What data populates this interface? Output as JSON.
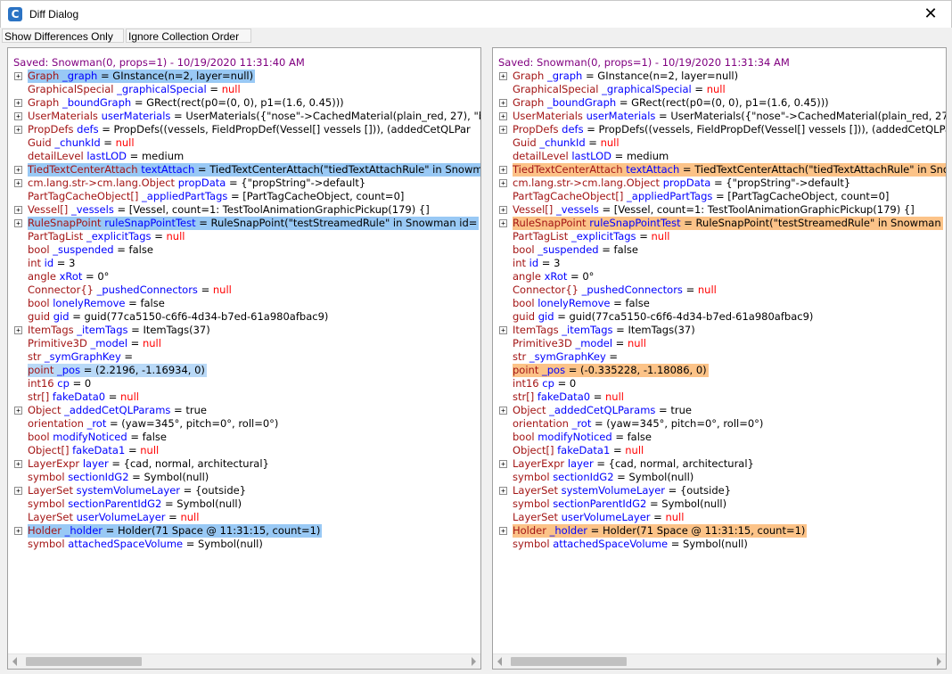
{
  "window": {
    "title": "Diff Dialog",
    "close": "✕",
    "app_icon": "C"
  },
  "toolbar": {
    "show_diffs": "Show Differences Only",
    "ignore_order": "Ignore Collection Order"
  },
  "left": {
    "header": "Saved: Snowman(0, props=1) - 10/19/2020 11:31:40 AM",
    "rows": [
      {
        "exp": true,
        "t": "Graph",
        "n": "_graph",
        "v": " = GInstance(n=2, layer=null)",
        "hl": "hl-blue",
        "nul": false
      },
      {
        "exp": false,
        "t": "GraphicalSpecial",
        "n": "_graphicalSpecial",
        "v": " = ",
        "nv": "null",
        "hl": ""
      },
      {
        "exp": true,
        "t": "Graph",
        "n": "_boundGraph",
        "v": " = GRect(rect(p0=(0, 0), p1=(1.6, 0.45)))",
        "hl": ""
      },
      {
        "exp": true,
        "t": "UserMaterials",
        "n": "userMaterials",
        "v": " = UserMaterials({\"nose\"->CachedMaterial(plain_red, 27), \"b",
        "hl": ""
      },
      {
        "exp": true,
        "t": "PropDefs",
        "n": "defs",
        "v": " = PropDefs((vessels, FieldPropDef(Vessel[] vessels [])), (addedCetQLPar",
        "hl": ""
      },
      {
        "exp": false,
        "t": "Guid",
        "n": "_chunkId",
        "v": " = ",
        "nv": "null",
        "hl": ""
      },
      {
        "exp": false,
        "t": "detailLevel",
        "n": "lastLOD",
        "v": " = medium",
        "hl": ""
      },
      {
        "exp": true,
        "t": "TiedTextCenterAttach",
        "n": "textAttach",
        "v": " = TiedTextCenterAttach(\"tiedTextAttachRule\" in Snowm",
        "hl": "hl-blue"
      },
      {
        "exp": true,
        "t": "cm.lang.str->cm.lang.Object",
        "n": "propData",
        "v": " = {\"propString\"->default}",
        "hl": ""
      },
      {
        "exp": false,
        "t": "PartTagCacheObject[]",
        "n": "_appliedPartTags",
        "v": " = [PartTagCacheObject, count=0]",
        "hl": ""
      },
      {
        "exp": true,
        "t": "Vessel[]",
        "n": "_vessels",
        "v": " = [Vessel, count=1: TestToolAnimationGraphicPickup(179) {]",
        "hl": ""
      },
      {
        "exp": true,
        "t": "RuleSnapPoint",
        "n": "ruleSnapPointTest",
        "v": " = RuleSnapPoint(\"testStreamedRule\" in Snowman id=",
        "hl": "hl-blue"
      },
      {
        "exp": false,
        "t": "PartTagList",
        "n": "_explicitTags",
        "v": " = ",
        "nv": "null",
        "hl": ""
      },
      {
        "exp": false,
        "t": "bool",
        "n": "_suspended",
        "v": " = false",
        "hl": ""
      },
      {
        "exp": false,
        "t": "int",
        "n": "id",
        "v": " = 3",
        "hl": ""
      },
      {
        "exp": false,
        "t": "angle",
        "n": "xRot",
        "v": " = 0°",
        "hl": ""
      },
      {
        "exp": false,
        "t": "Connector{}",
        "n": "_pushedConnectors",
        "v": " = ",
        "nv": "null",
        "hl": ""
      },
      {
        "exp": false,
        "t": "bool",
        "n": "lonelyRemove",
        "v": " = false",
        "hl": ""
      },
      {
        "exp": false,
        "t": "guid",
        "n": "gid",
        "v": " = guid(77ca5150-c6f6-4d34-b7ed-61a980afbac9)",
        "hl": ""
      },
      {
        "exp": true,
        "t": "ItemTags",
        "n": "_itemTags",
        "v": " = ItemTags(37)",
        "hl": ""
      },
      {
        "exp": false,
        "t": "Primitive3D",
        "n": "_model",
        "v": " = ",
        "nv": "null",
        "hl": ""
      },
      {
        "exp": false,
        "t": "str",
        "n": "_symGraphKey",
        "v": " =",
        "hl": ""
      },
      {
        "exp": false,
        "t": "point",
        "n": "_pos",
        "v": " = (2.2196, -1.16934, 0)",
        "hl": "hl-blue2"
      },
      {
        "exp": false,
        "t": "int16",
        "n": "cp",
        "v": " = 0",
        "hl": ""
      },
      {
        "exp": false,
        "t": "str[]",
        "n": "fakeData0",
        "v": " = ",
        "nv": "null",
        "hl": ""
      },
      {
        "exp": true,
        "t": "Object",
        "n": "_addedCetQLParams",
        "v": " = true",
        "hl": ""
      },
      {
        "exp": false,
        "t": "orientation",
        "n": "_rot",
        "v": " = (yaw=345°, pitch=0°, roll=0°)",
        "hl": ""
      },
      {
        "exp": false,
        "t": "bool",
        "n": "modifyNoticed",
        "v": " = false",
        "hl": ""
      },
      {
        "exp": false,
        "t": "Object[]",
        "n": "fakeData1",
        "v": " = ",
        "nv": "null",
        "hl": ""
      },
      {
        "exp": true,
        "t": "LayerExpr",
        "n": "layer",
        "v": " = {cad, normal, architectural}",
        "hl": ""
      },
      {
        "exp": false,
        "t": "symbol",
        "n": "sectionIdG2",
        "v": " = Symbol(null)",
        "hl": ""
      },
      {
        "exp": true,
        "t": "LayerSet",
        "n": "systemVolumeLayer",
        "v": " = {outside}",
        "hl": ""
      },
      {
        "exp": false,
        "t": "symbol",
        "n": "sectionParentIdG2",
        "v": " = Symbol(null)",
        "hl": ""
      },
      {
        "exp": false,
        "t": "LayerSet",
        "n": "userVolumeLayer",
        "v": " = ",
        "nv": "null",
        "hl": ""
      },
      {
        "exp": true,
        "t": "Holder",
        "n": "_holder",
        "v": " = Holder(71 Space @ 11:31:15, count=1)",
        "hl": "hl-blue"
      },
      {
        "exp": false,
        "t": "symbol",
        "n": "attachedSpaceVolume",
        "v": " = Symbol(null)",
        "hl": ""
      }
    ]
  },
  "right": {
    "header": "Saved: Snowman(0, props=1) - 10/19/2020 11:31:34 AM",
    "rows": [
      {
        "exp": true,
        "t": "Graph",
        "n": "_graph",
        "v": " = GInstance(n=2, layer=null)",
        "hl": ""
      },
      {
        "exp": false,
        "t": "GraphicalSpecial",
        "n": "_graphicalSpecial",
        "v": " = ",
        "nv": "null",
        "hl": ""
      },
      {
        "exp": true,
        "t": "Graph",
        "n": "_boundGraph",
        "v": " = GRect(rect(p0=(0, 0), p1=(1.6, 0.45)))",
        "hl": ""
      },
      {
        "exp": true,
        "t": "UserMaterials",
        "n": "userMaterials",
        "v": " = UserMaterials({\"nose\"->CachedMaterial(plain_red, 27)",
        "hl": ""
      },
      {
        "exp": true,
        "t": "PropDefs",
        "n": "defs",
        "v": " = PropDefs((vessels, FieldPropDef(Vessel[] vessels [])), (addedCetQLPa",
        "hl": ""
      },
      {
        "exp": false,
        "t": "Guid",
        "n": "_chunkId",
        "v": " = ",
        "nv": "null",
        "hl": ""
      },
      {
        "exp": false,
        "t": "detailLevel",
        "n": "lastLOD",
        "v": " = medium",
        "hl": ""
      },
      {
        "exp": true,
        "t": "TiedTextCenterAttach",
        "n": "textAttach",
        "v": " = TiedTextCenterAttach(\"tiedTextAttachRule\" in Sno",
        "hl": "hl-orange"
      },
      {
        "exp": true,
        "t": "cm.lang.str->cm.lang.Object",
        "n": "propData",
        "v": " = {\"propString\"->default}",
        "hl": ""
      },
      {
        "exp": false,
        "t": "PartTagCacheObject[]",
        "n": "_appliedPartTags",
        "v": " = [PartTagCacheObject, count=0]",
        "hl": ""
      },
      {
        "exp": true,
        "t": "Vessel[]",
        "n": "_vessels",
        "v": " = [Vessel, count=1: TestToolAnimationGraphicPickup(179) {]",
        "hl": ""
      },
      {
        "exp": true,
        "t": "RuleSnapPoint",
        "n": "ruleSnapPointTest",
        "v": " = RuleSnapPoint(\"testStreamedRule\" in Snowman",
        "hl": "hl-orange"
      },
      {
        "exp": false,
        "t": "PartTagList",
        "n": "_explicitTags",
        "v": " = ",
        "nv": "null",
        "hl": ""
      },
      {
        "exp": false,
        "t": "bool",
        "n": "_suspended",
        "v": " = false",
        "hl": ""
      },
      {
        "exp": false,
        "t": "int",
        "n": "id",
        "v": " = 3",
        "hl": ""
      },
      {
        "exp": false,
        "t": "angle",
        "n": "xRot",
        "v": " = 0°",
        "hl": ""
      },
      {
        "exp": false,
        "t": "Connector{}",
        "n": "_pushedConnectors",
        "v": " = ",
        "nv": "null",
        "hl": ""
      },
      {
        "exp": false,
        "t": "bool",
        "n": "lonelyRemove",
        "v": " = false",
        "hl": ""
      },
      {
        "exp": false,
        "t": "guid",
        "n": "gid",
        "v": " = guid(77ca5150-c6f6-4d34-b7ed-61a980afbac9)",
        "hl": ""
      },
      {
        "exp": true,
        "t": "ItemTags",
        "n": "_itemTags",
        "v": " = ItemTags(37)",
        "hl": ""
      },
      {
        "exp": false,
        "t": "Primitive3D",
        "n": "_model",
        "v": " = ",
        "nv": "null",
        "hl": ""
      },
      {
        "exp": false,
        "t": "str",
        "n": "_symGraphKey",
        "v": " =",
        "hl": ""
      },
      {
        "exp": false,
        "t": "point",
        "n": "_pos",
        "v": " = (-0.335228, -1.18086, 0)",
        "hl": "hl-orange"
      },
      {
        "exp": false,
        "t": "int16",
        "n": "cp",
        "v": " = 0",
        "hl": ""
      },
      {
        "exp": false,
        "t": "str[]",
        "n": "fakeData0",
        "v": " = ",
        "nv": "null",
        "hl": ""
      },
      {
        "exp": true,
        "t": "Object",
        "n": "_addedCetQLParams",
        "v": " = true",
        "hl": ""
      },
      {
        "exp": false,
        "t": "orientation",
        "n": "_rot",
        "v": " = (yaw=345°, pitch=0°, roll=0°)",
        "hl": ""
      },
      {
        "exp": false,
        "t": "bool",
        "n": "modifyNoticed",
        "v": " = false",
        "hl": ""
      },
      {
        "exp": false,
        "t": "Object[]",
        "n": "fakeData1",
        "v": " = ",
        "nv": "null",
        "hl": ""
      },
      {
        "exp": true,
        "t": "LayerExpr",
        "n": "layer",
        "v": " = {cad, normal, architectural}",
        "hl": ""
      },
      {
        "exp": false,
        "t": "symbol",
        "n": "sectionIdG2",
        "v": " = Symbol(null)",
        "hl": ""
      },
      {
        "exp": true,
        "t": "LayerSet",
        "n": "systemVolumeLayer",
        "v": " = {outside}",
        "hl": ""
      },
      {
        "exp": false,
        "t": "symbol",
        "n": "sectionParentIdG2",
        "v": " = Symbol(null)",
        "hl": ""
      },
      {
        "exp": false,
        "t": "LayerSet",
        "n": "userVolumeLayer",
        "v": " = ",
        "nv": "null",
        "hl": ""
      },
      {
        "exp": true,
        "t": "Holder",
        "n": "_holder",
        "v": " = Holder(71 Space @ 11:31:15, count=1)",
        "hl": "hl-orange"
      },
      {
        "exp": false,
        "t": "symbol",
        "n": "attachedSpaceVolume",
        "v": " = Symbol(null)",
        "hl": ""
      }
    ]
  }
}
